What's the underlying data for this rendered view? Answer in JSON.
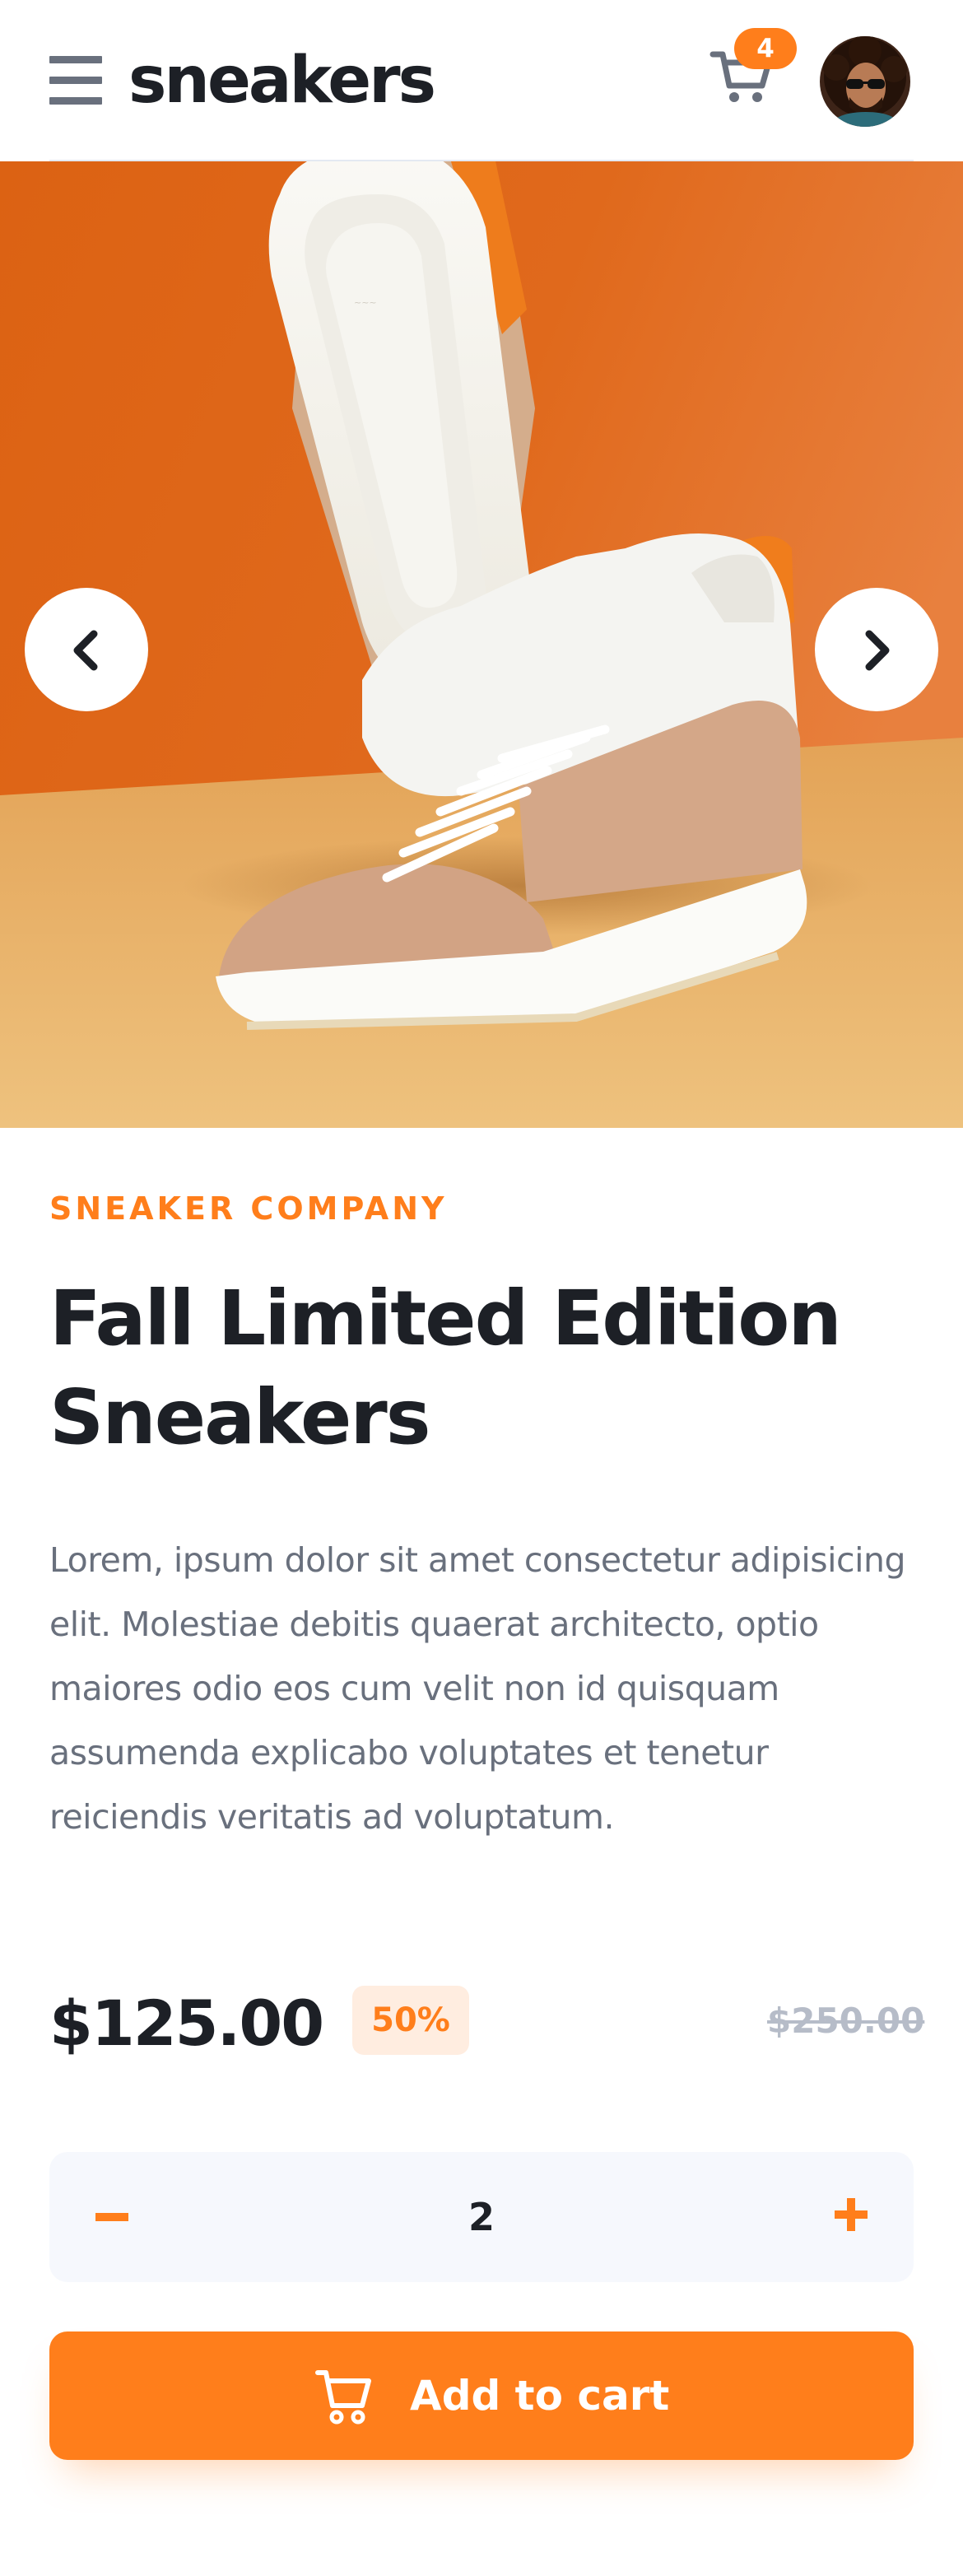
{
  "header": {
    "logo": "sneakers",
    "cart_count": "4"
  },
  "gallery": {
    "image": "sneaker-product-photo"
  },
  "product": {
    "company": "SNEAKER COMPANY",
    "title": "Fall Limited Edition Sneakers",
    "description": "Lorem, ipsum dolor sit amet consectetur adipisicing elit. Molestiae debitis quaerat architecto, optio maiores odio eos cum velit non id quisquam assumenda explicabo voluptates et tenetur reiciendis veritatis ad voluptatum.",
    "price": "$125.00",
    "discount": "50%",
    "old_price": "$250.00"
  },
  "quantity": {
    "value": "2"
  },
  "cart_button": {
    "label": "Add to cart"
  },
  "colors": {
    "accent": "#ff7e1b",
    "accent_pale": "#ffede0",
    "text_dark": "#1d2026",
    "text_muted": "#69707d",
    "surface_light": "#f6f8fd"
  },
  "icons": {
    "menu": "menu-icon",
    "cart": "cart-icon",
    "prev": "chevron-left-icon",
    "next": "chevron-right-icon",
    "minus": "minus-icon",
    "plus": "plus-icon"
  }
}
